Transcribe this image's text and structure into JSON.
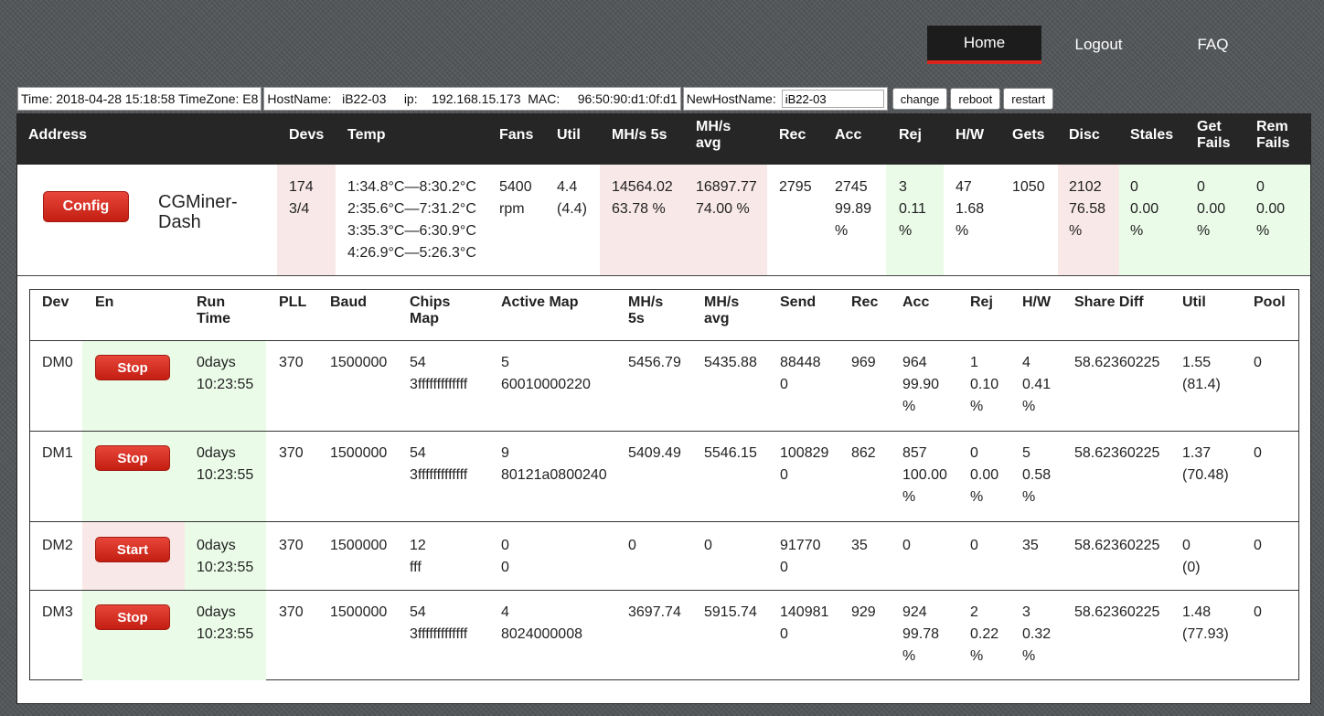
{
  "nav": {
    "home": "Home",
    "logout": "Logout",
    "faq": "FAQ"
  },
  "info": {
    "time": "Time: 2018-04-28 15:18:58 TimeZone: E8",
    "hostname": "HostName:   iB22-03     ip:    192.168.15.173  MAC:     96:50:90:d1:0f:d1",
    "new_host_label": "NewHostName:",
    "new_host_value": "iB22-03",
    "change": "change",
    "reboot": "reboot",
    "restart": "restart"
  },
  "summary": {
    "headers": {
      "address": "Address",
      "devs": "Devs",
      "temp": "Temp",
      "fans": "Fans",
      "util": "Util",
      "mhs5s": "MH/s 5s",
      "mhsavg1": "MH/s",
      "mhsavg2": "avg",
      "rec": "Rec",
      "acc": "Acc",
      "rej": "Rej",
      "hw": "H/W",
      "gets": "Gets",
      "disc": "Disc",
      "stales": "Stales",
      "getfails1": "Get",
      "getfails2": "Fails",
      "remfails1": "Rem",
      "remfails2": "Fails"
    },
    "config": "Config",
    "title1": "CGMiner-",
    "title2": "Dash",
    "devs": [
      "174",
      "3/4"
    ],
    "temp": [
      "1:34.8°C—8:30.2°C",
      "2:35.6°C—7:31.2°C",
      "3:35.3°C—6:30.9°C",
      "4:26.9°C—5:26.3°C"
    ],
    "fans": [
      "5400",
      "rpm"
    ],
    "util": [
      "4.4",
      "(4.4)"
    ],
    "mhs5s": [
      "14564.02",
      "63.78 %"
    ],
    "mhsavg": [
      "16897.77",
      "74.00 %"
    ],
    "rec": [
      "2795"
    ],
    "acc": [
      "2745",
      "99.89",
      "%"
    ],
    "rej": [
      "3",
      "0.11",
      "%"
    ],
    "hw": [
      "47",
      "1.68",
      "%"
    ],
    "gets": [
      "1050"
    ],
    "disc": [
      "2102",
      "76.58",
      "%"
    ],
    "stales": [
      "0",
      "0.00",
      "%"
    ],
    "getfails": [
      "0",
      "0.00",
      "%"
    ],
    "remfails": [
      "0",
      "0.00",
      "%"
    ]
  },
  "devices": {
    "headers": {
      "dev": "Dev",
      "en": "En",
      "run1": "Run",
      "run2": "Time",
      "pll": "PLL",
      "baud": "Baud",
      "chips1": "Chips",
      "chips2": "Map",
      "active": "Active Map",
      "mhs5s1": "MH/s",
      "mhs5s2": "5s",
      "mhsavg1": "MH/s",
      "mhsavg2": "avg",
      "send": "Send",
      "rec": "Rec",
      "acc": "Acc",
      "rej": "Rej",
      "hw": "H/W",
      "sharediff": "Share Diff",
      "util": "Util",
      "pool": "Pool"
    },
    "rows": [
      {
        "dev": "DM0",
        "btn": "Stop",
        "run1": "0days",
        "run2": "10:23:55",
        "pll": "370",
        "baud": "1500000",
        "chips1": "54",
        "chips2": "3fffffffffffff",
        "active1": "5",
        "active2": "60010000220",
        "mhs5s": "5456.79",
        "mhsavg": "5435.88",
        "send1": "88448",
        "send2": "0",
        "rec": "969",
        "acc1": "964",
        "acc2": "99.90",
        "acc3": "%",
        "rej1": "1",
        "rej2": "0.10",
        "rej3": "%",
        "hw1": "4",
        "hw2": "0.41",
        "hw3": "%",
        "sharediff": "58.62360225",
        "util1": "1.55",
        "util2": "(81.4)",
        "pool": "0"
      },
      {
        "dev": "DM1",
        "btn": "Stop",
        "run1": "0days",
        "run2": "10:23:55",
        "pll": "370",
        "baud": "1500000",
        "chips1": "54",
        "chips2": "3fffffffffffff",
        "active1": "9",
        "active2": "80121a0800240",
        "mhs5s": "5409.49",
        "mhsavg": "5546.15",
        "send1": "100829",
        "send2": "0",
        "rec": "862",
        "acc1": "857",
        "acc2": "100.00",
        "acc3": "%",
        "rej1": "0",
        "rej2": "0.00",
        "rej3": "%",
        "hw1": "5",
        "hw2": "0.58",
        "hw3": "%",
        "sharediff": "58.62360225",
        "util1": "1.37",
        "util2": "(70.48)",
        "pool": "0"
      },
      {
        "dev": "DM2",
        "btn": "Start",
        "run1": "0days",
        "run2": "10:23:55",
        "pll": "370",
        "baud": "1500000",
        "chips1": "12",
        "chips2": "fff",
        "active1": "0",
        "active2": "0",
        "mhs5s": "0",
        "mhsavg": "0",
        "send1": "91770",
        "send2": "0",
        "rec": "35",
        "acc1": "0",
        "acc2": "",
        "acc3": "",
        "rej1": "0",
        "rej2": "",
        "rej3": "",
        "hw1": "35",
        "hw2": "",
        "hw3": "",
        "sharediff": "58.62360225",
        "util1": "0",
        "util2": "(0)",
        "pool": "0"
      },
      {
        "dev": "DM3",
        "btn": "Stop",
        "run1": "0days",
        "run2": "10:23:55",
        "pll": "370",
        "baud": "1500000",
        "chips1": "54",
        "chips2": "3fffffffffffff",
        "active1": "4",
        "active2": "8024000008",
        "mhs5s": "3697.74",
        "mhsavg": "5915.74",
        "send1": "140981",
        "send2": "0",
        "rec": "929",
        "acc1": "924",
        "acc2": "99.78",
        "acc3": "%",
        "rej1": "2",
        "rej2": "0.22",
        "rej3": "%",
        "hw1": "3",
        "hw2": "0.32",
        "hw3": "%",
        "sharediff": "58.62360225",
        "util1": "1.48",
        "util2": "(77.93)",
        "pool": "0"
      }
    ]
  }
}
